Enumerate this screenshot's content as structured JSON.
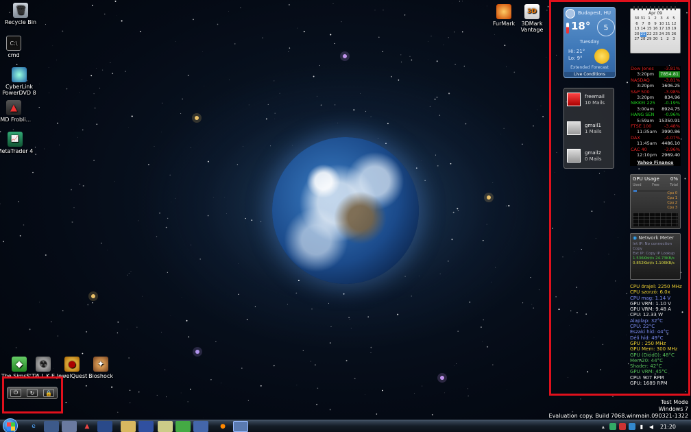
{
  "desktop_icons": {
    "recycle_bin": "Recycle Bin",
    "cmd": "cmd",
    "powerdvd": "CyberLink PowerDVD 8",
    "amd": "AMD Frobli...",
    "metatrader": "MetaTrader 4",
    "furmark": "FurMark",
    "vantage": "3DMark Vantage",
    "sims": "The Sims™ 2",
    "stalker": "S.T.A.L.K.E...",
    "jewelquest": "JewelQuest",
    "bioshock": "Bioshock"
  },
  "weather": {
    "city": "Budapest, HU",
    "temp": "18°",
    "dial": "5",
    "day": "Tuesday",
    "hi": "Hi: 21°",
    "lo": "Lo: 9°",
    "extended": "Extended Forecast",
    "live": "Live Conditions"
  },
  "calendar": {
    "month": "Apr 09",
    "rows": [
      [
        "30",
        "31",
        "1",
        "2",
        "3",
        "4",
        "5"
      ],
      [
        "6",
        "7",
        "8",
        "9",
        "10",
        "11",
        "12"
      ],
      [
        "13",
        "14",
        "15",
        "16",
        "17",
        "18",
        "19"
      ],
      [
        "20",
        "21",
        "22",
        "23",
        "24",
        "25",
        "26"
      ],
      [
        "27",
        "28",
        "29",
        "30",
        "1",
        "2",
        "3"
      ]
    ],
    "today": "21"
  },
  "mail": [
    {
      "account": "freemail",
      "count": "10 Mails"
    },
    {
      "account": "gmail1",
      "count": "1 Mails"
    },
    {
      "account": "gmail2",
      "count": "0 Mails"
    }
  ],
  "finance": {
    "quotes": [
      {
        "name": "Dow Jones",
        "change": "-3.81%",
        "dir": "down",
        "time": "3:20pm",
        "value": "7854.81",
        "highlight": true
      },
      {
        "name": "NASDAQ",
        "change": "-3.81%",
        "dir": "down",
        "time": "3:20pm",
        "value": "1606.25"
      },
      {
        "name": "S&P 500",
        "change": "-3.98%",
        "dir": "down",
        "time": "3:20pm",
        "value": "834.96"
      },
      {
        "name": "NIKKEI 225",
        "change": "-0.19%",
        "dir": "up",
        "time": "3:00am",
        "value": "8924.75"
      },
      {
        "name": "HANG SEN",
        "change": "-0.96%",
        "dir": "up",
        "time": "5:59am",
        "value": "15350.91"
      },
      {
        "name": "FTSE 100",
        "change": "-3.48%",
        "dir": "down",
        "time": "11:35am",
        "value": "3990.86"
      },
      {
        "name": "DAX",
        "change": "-4.07%",
        "dir": "down",
        "time": "11:45am",
        "value": "4486.10"
      },
      {
        "name": "CAC 40",
        "change": "-3.96%",
        "dir": "down",
        "time": "12:10pm",
        "value": "2969.40"
      }
    ],
    "brand": "Yahoo Finance"
  },
  "gpu": {
    "title": "GPU Usage",
    "percent": "0%",
    "bar_level": 0.1,
    "cols": [
      "Used",
      "Free",
      "Total"
    ],
    "cpus": [
      "Cpu 0",
      "Cpu 1",
      "Cpu 2",
      "Cpu 3"
    ]
  },
  "net": {
    "title": "Network Meter",
    "lines": [
      "Int IP: No connection Copy",
      "Ext IP: Copy  IP Lookup",
      "1.536Kbit/s  24.73KB/s",
      "0.852Kbit/s  1.106KB/s"
    ]
  },
  "sensors": [
    {
      "text": "CPU órajel: 2250 MHz",
      "c": "y"
    },
    {
      "text": "CPU szorzó: 6.0x",
      "c": "y"
    },
    {
      "text": "CPU mag: 1.14 V",
      "c": "b"
    },
    {
      "text": "GPU VRM: 1.10 V",
      "c": "w"
    },
    {
      "text": "GPU VRM: 9.48 A",
      "c": "w"
    },
    {
      "text": "CPU: 12.33 W",
      "c": "w"
    },
    {
      "text": "Alaplap: 32°C",
      "c": "b"
    },
    {
      "text": "CPU: 22°C",
      "c": "b"
    },
    {
      "text": "Északi híd: 44°C",
      "c": "b"
    },
    {
      "text": "Déli híd: 49°C",
      "c": "b"
    },
    {
      "text": "GPU : 250 MHz",
      "c": "y"
    },
    {
      "text": "GPU Mem: 300 MHz",
      "c": "y"
    },
    {
      "text": "GPU (Diód0): 48°C",
      "c": "g"
    },
    {
      "text": "Mem20: 44°C",
      "c": "g"
    },
    {
      "text": "Shader: 42°C",
      "c": "g"
    },
    {
      "text": "GPU VRM: 45°C",
      "c": "g"
    },
    {
      "text": "CPU: 907 RPM",
      "c": "w"
    },
    {
      "text": "GPU: 1689 RPM",
      "c": "w"
    }
  ],
  "watermark": {
    "line1": "Test Mode",
    "line2": "Windows 7",
    "line3": "Evaluation copy. Build 7068.winmain.090321-1322"
  },
  "clock": "21:20",
  "colors": {
    "annotation_red": "#e0101c",
    "finance_down": "#e02020",
    "finance_up": "#20d020"
  }
}
